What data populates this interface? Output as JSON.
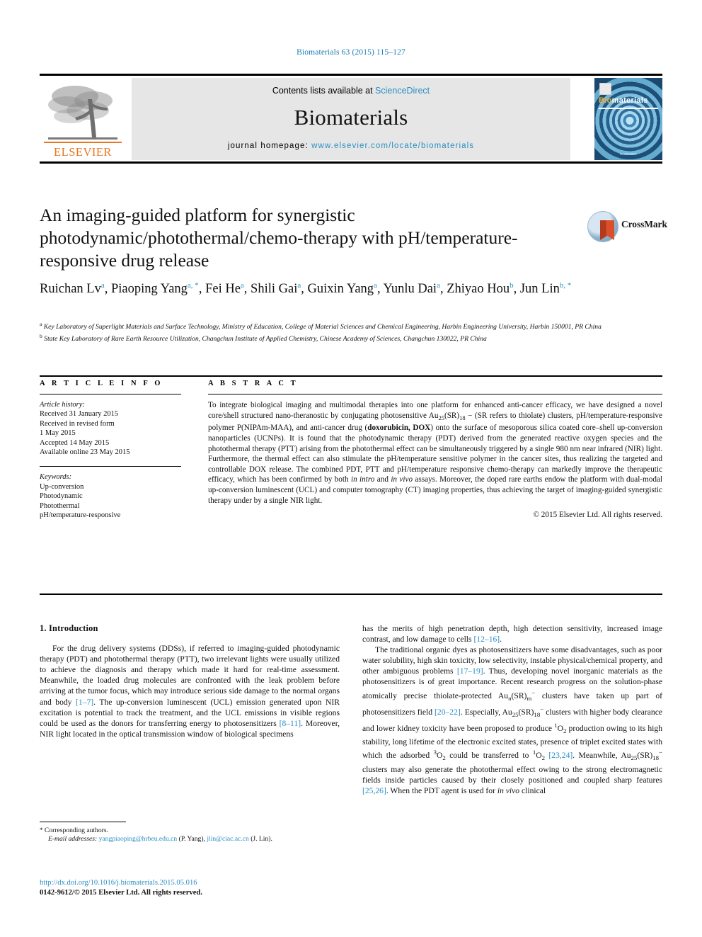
{
  "running_head": "Biomaterials 63 (2015) 115–127",
  "masthead": {
    "publisher_name": "ELSEVIER",
    "contents_prefix": "Contents lists available at ",
    "contents_link": "ScienceDirect",
    "journal_name": "Biomaterials",
    "homepage_prefix": "journal homepage: ",
    "homepage_url": "www.elsevier.com/locate/biomaterials",
    "cover_title_bio": "Bio",
    "cover_title_rest": "materials",
    "cover_footer": "ELSEVIER"
  },
  "crossmark": {
    "label": "CrossMark"
  },
  "title": "An imaging-guided platform for synergistic photodynamic/photothermal/chemo-therapy with pH/temperature-responsive drug release",
  "authors": [
    {
      "name": "Ruichan Lv",
      "marks": "a",
      "sep": ", "
    },
    {
      "name": "Piaoping Yang",
      "marks": "a, *",
      "sep": ", "
    },
    {
      "name": "Fei He",
      "marks": "a",
      "sep": ", "
    },
    {
      "name": "Shili Gai",
      "marks": "a",
      "sep": ", "
    },
    {
      "name": "Guixin Yang",
      "marks": "a",
      "sep": ", "
    },
    {
      "name": "Yunlu Dai",
      "marks": "a",
      "sep": ", "
    },
    {
      "name": "Zhiyao Hou",
      "marks": "b",
      "sep": ", "
    },
    {
      "name": "Jun Lin",
      "marks": "b, *",
      "sep": ""
    }
  ],
  "affiliations": [
    {
      "mark": "a",
      "text": "Key Laboratory of Superlight Materials and Surface Technology, Ministry of Education, College of Material Sciences and Chemical Engineering, Harbin Engineering University, Harbin 150001, PR China"
    },
    {
      "mark": "b",
      "text": "State Key Laboratory of Rare Earth Resource Utilization, Changchun Institute of Applied Chemistry, Chinese Academy of Sciences, Changchun 130022, PR China"
    }
  ],
  "article_info": {
    "heading": "A R T I C L E   I N F O",
    "history_label": "Article history:",
    "history": [
      "Received 31 January 2015",
      "Received in revised form",
      "1 May 2015",
      "Accepted 14 May 2015",
      "Available online 23 May 2015"
    ],
    "keywords_label": "Keywords:",
    "keywords": [
      "Up-conversion",
      "Photodynamic",
      "Photothermal",
      "pH/temperature-responsive"
    ]
  },
  "abstract": {
    "heading": "A B S T R A C T",
    "copyright": "© 2015 Elsevier Ltd. All rights reserved."
  },
  "introduction": {
    "heading": "1. Introduction"
  },
  "footnote": {
    "star": "*",
    "corresponding": "Corresponding authors.",
    "emails_label": "E-mail addresses:",
    "email1": "yangpiaoping@hrbeu.edu.cn",
    "email1_owner": "(P. Yang),",
    "email2": "jlin@ciac.ac.cn",
    "email2_owner": "(J. Lin)."
  },
  "doi_block": {
    "doi": "http://dx.doi.org/10.1016/j.biomaterials.2015.05.016",
    "issn": "0142-9612/© 2015 Elsevier Ltd. All rights reserved."
  },
  "colors": {
    "link_blue": "#2a8fc4",
    "running_head_blue": "#1a7bb0",
    "elsevier_orange": "#e87722",
    "banner_gray": "#e6e6e6"
  }
}
